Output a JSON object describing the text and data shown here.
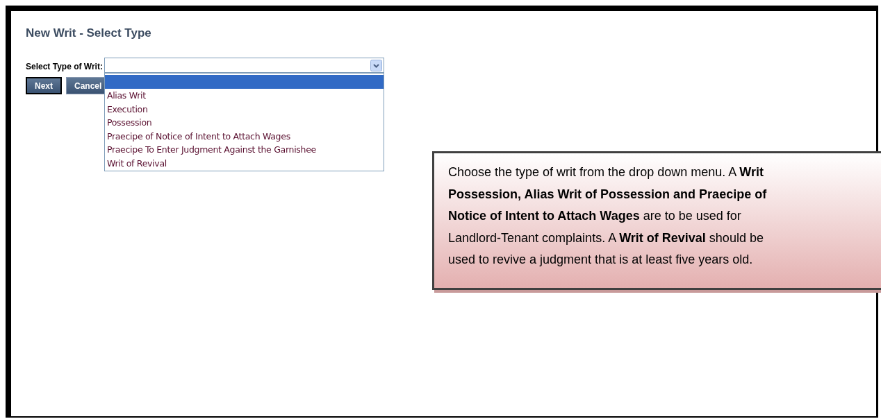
{
  "page_title": "New Writ - Select Type",
  "form": {
    "label": "Select Type of Writ:",
    "dropdown": {
      "expanded": true,
      "options": [
        {
          "selected": true
        },
        {
          "label": "Alias Writ",
          "selected": false
        },
        {
          "label": "Execution",
          "selected": false
        },
        {
          "label": "Possession",
          "selected": false
        },
        {
          "label": "Praecipe of Notice of Intent to Attach Wages",
          "selected": false
        },
        {
          "label": "Praecipe To Enter Judgment Against the Garnishee",
          "selected": false
        },
        {
          "label": "Writ of Revival",
          "selected": false
        }
      ]
    }
  },
  "buttons": [
    {
      "label": "Next",
      "focused": true
    },
    {
      "label": "Cancel",
      "focused": false
    }
  ],
  "callout": {
    "lines": [
      "Choose the type of writ from the drop down menu.  A **Writ**",
      "**Possession, Alias Writ of Possession and Praecipe of**",
      "**Notice of Intent to Attach Wages** are to be used for",
      "Landlord-Tenant complaints.  A **Writ of Revival** should be",
      "used to revive a judgment that is at least five years old."
    ]
  }
}
